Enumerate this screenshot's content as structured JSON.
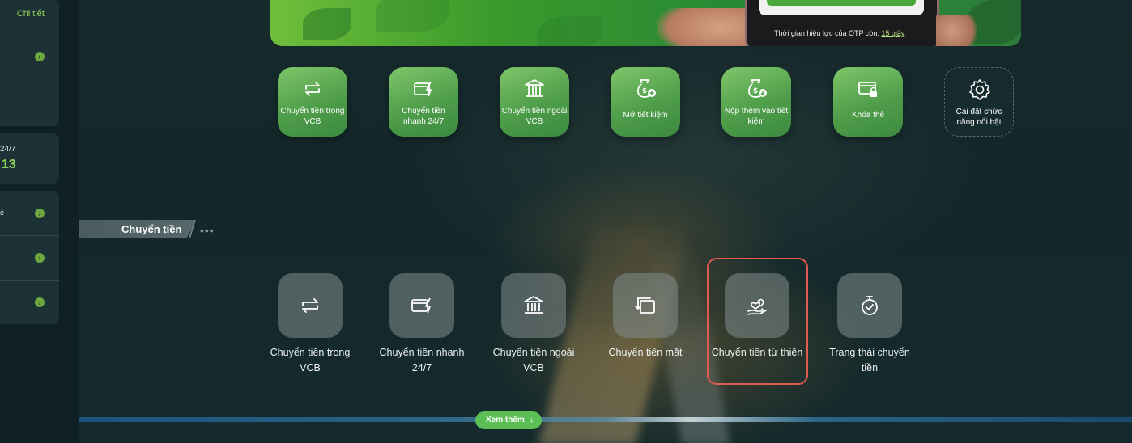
{
  "sidebar": {
    "detail_link": "Chi tiết",
    "card2_small": "24/7",
    "card2_big": "13",
    "card3_mark": "é"
  },
  "banner": {
    "otp_prefix": "Thời gian hiệu lực của OTP còn: ",
    "otp_seconds": "15 giây"
  },
  "featured": [
    {
      "label": "Chuyển tiền trong VCB",
      "icon": "transfer-arrows-icon"
    },
    {
      "label": "Chuyển tiền nhanh 24/7",
      "icon": "card-lightning-icon"
    },
    {
      "label": "Chuyển tiền ngoài VCB",
      "icon": "bank-icon"
    },
    {
      "label": "Mở tiết kiệm",
      "icon": "money-bag-plus-icon"
    },
    {
      "label": "Nộp thêm vào tiết kiệm",
      "icon": "money-bag-down-icon"
    },
    {
      "label": "Khóa thẻ",
      "icon": "card-lock-icon"
    },
    {
      "label": "Cài đặt chức năng nổi bật",
      "icon": "gear-icon"
    }
  ],
  "section": {
    "title": "Chuyển tiền",
    "more": "•••"
  },
  "transfer_tiles": [
    {
      "label": "Chuyển tiền trong VCB",
      "icon": "transfer-arrows-icon"
    },
    {
      "label": "Chuyển tiền nhanh 24/7",
      "icon": "card-lightning-icon"
    },
    {
      "label": "Chuyển tiền ngoài VCB",
      "icon": "bank-icon"
    },
    {
      "label": "Chuyển tiền mặt",
      "icon": "cash-transfer-icon"
    },
    {
      "label": "Chuyển tiền từ thiện",
      "icon": "charity-heart-hand-icon"
    },
    {
      "label": "Trạng thái chuyển tiền",
      "icon": "stopwatch-check-icon"
    }
  ],
  "bottom": {
    "see_more": "Xem thêm",
    "see_more_arrow": "↓"
  },
  "colors": {
    "brand_green": "#5cbf56",
    "highlight_red": "#e05a52",
    "background": "#13272a"
  }
}
